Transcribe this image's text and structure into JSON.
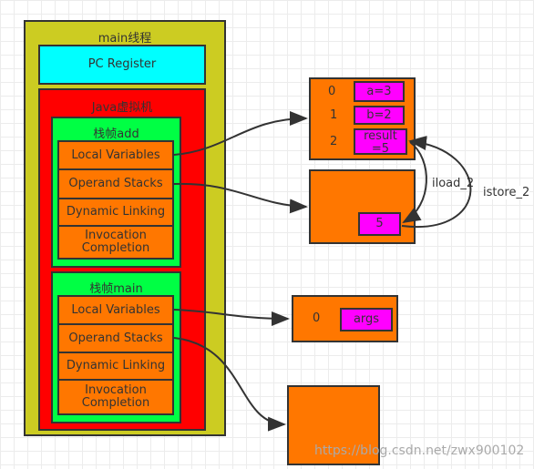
{
  "thread": {
    "title": "main线程",
    "pc_register": "PC Register",
    "jvm": "Java虚拟机",
    "frames": [
      {
        "title": "栈帧add",
        "items": [
          "Local Variables",
          "Operand Stacks",
          "Dynamic Linking",
          "Invocation Completion"
        ]
      },
      {
        "title": "栈帧main",
        "items": [
          "Local Variables",
          "Operand Stacks",
          "Dynamic Linking",
          "Invocation Completion"
        ]
      }
    ]
  },
  "add_locals": {
    "indices": [
      "0",
      "1",
      "2"
    ],
    "values": [
      "a=3",
      "b=2",
      "result =5"
    ]
  },
  "add_stack": {
    "values": [
      "5"
    ]
  },
  "main_locals": {
    "indices": [
      "0"
    ],
    "values": [
      "args"
    ]
  },
  "edges": {
    "load": "iload_2",
    "store": "istore_2"
  },
  "watermark": "https://blog.csdn.net/zwx900102",
  "colors": {
    "thread": "#cccc22",
    "pc": "#00ffff",
    "jvm": "#ff0000",
    "frame": "#00ff44",
    "slot": "#ff7700",
    "value": "#ff00ff"
  }
}
